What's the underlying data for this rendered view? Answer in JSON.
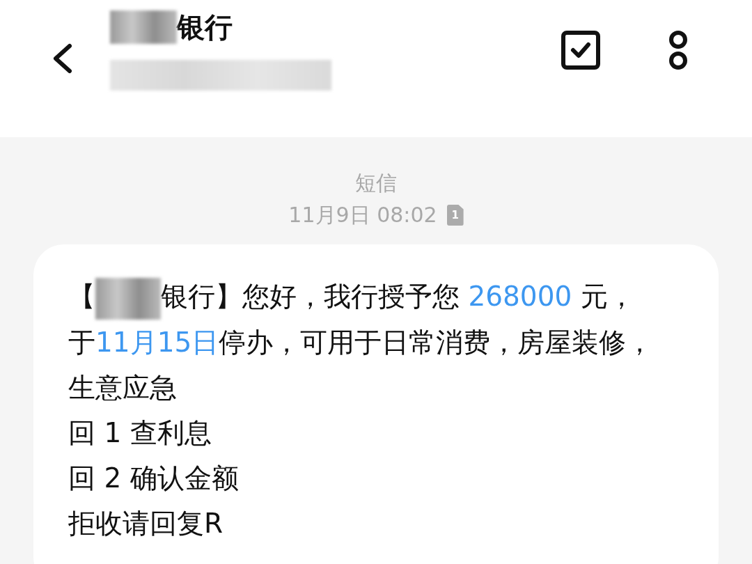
{
  "header": {
    "title": "银行",
    "title_redacted": true,
    "subtitle_redacted": true
  },
  "meta": {
    "channel": "短信",
    "time": "11月9日 08:02",
    "sim": "1"
  },
  "message": {
    "paragraphs": [
      {
        "segments": [
          {
            "kind": "text",
            "text": "【"
          },
          {
            "kind": "redacted"
          },
          {
            "kind": "text",
            "text": "银行】您好，我行授予您 "
          },
          {
            "kind": "link",
            "text": "268000"
          },
          {
            "kind": "text",
            "text": " 元，于"
          },
          {
            "kind": "link",
            "text": "11月15日"
          },
          {
            "kind": "text",
            "text": "停办，可用于日常消费，房屋装修，生意应急"
          }
        ]
      },
      {
        "segments": [
          {
            "kind": "text",
            "text": "回 1 查利息"
          }
        ]
      },
      {
        "segments": [
          {
            "kind": "text",
            "text": "回 2 确认金额"
          }
        ]
      },
      {
        "segments": [
          {
            "kind": "text",
            "text": "拒收请回复R"
          }
        ]
      }
    ]
  }
}
